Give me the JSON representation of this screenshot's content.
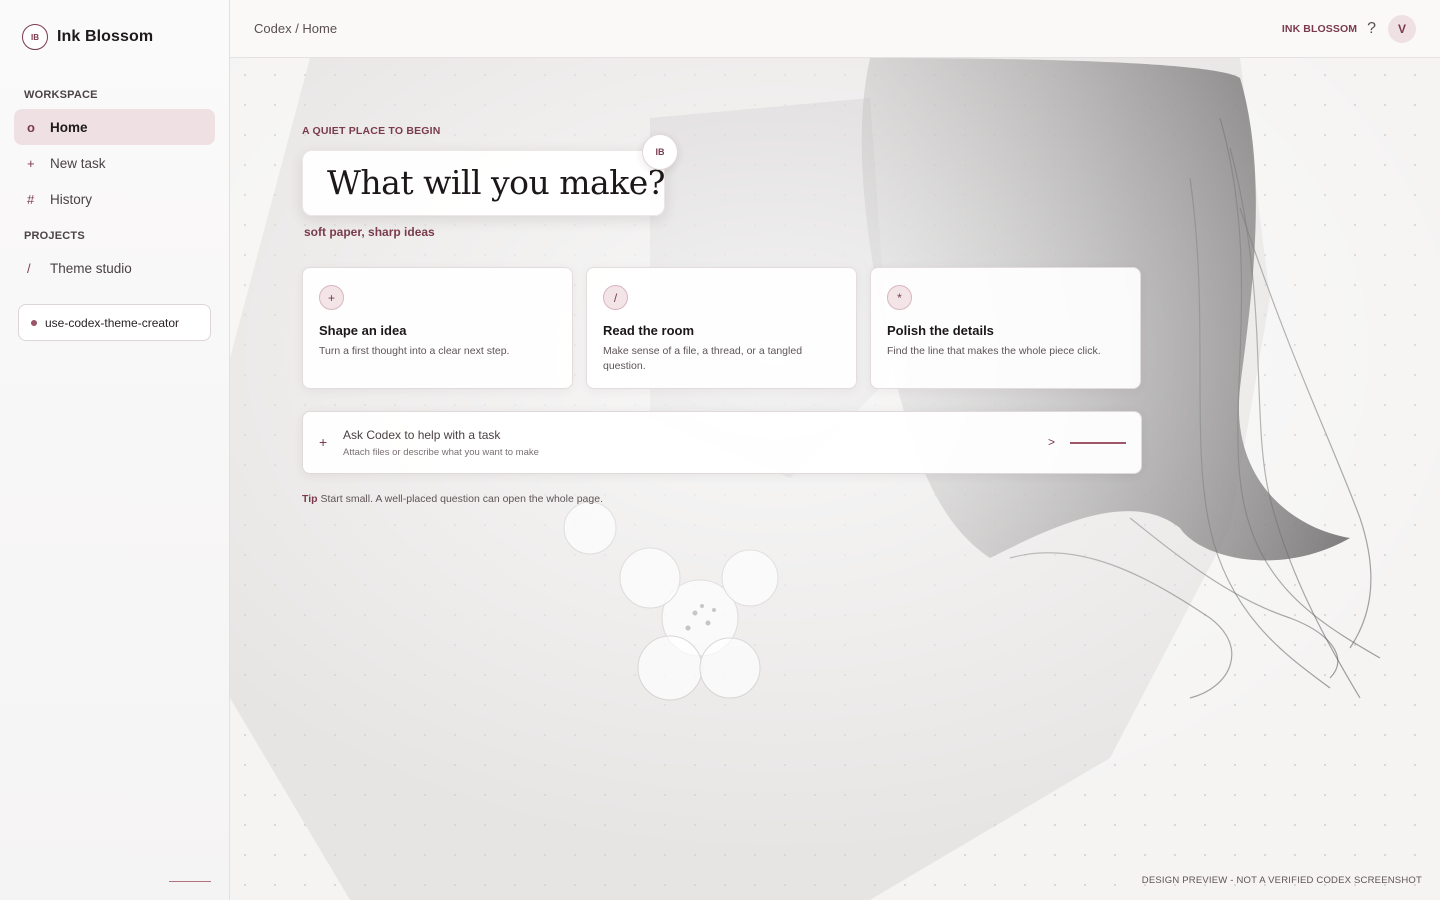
{
  "brand": {
    "mark": "IB",
    "name": "Ink Blossom"
  },
  "sidebar": {
    "workspace_label": "WORKSPACE",
    "workspace_items": [
      {
        "glyph": "o",
        "label": "Home",
        "active": true
      },
      {
        "glyph": "+",
        "label": "New task",
        "active": false
      },
      {
        "glyph": "#",
        "label": "History",
        "active": false
      }
    ],
    "projects_label": "PROJECTS",
    "project_items": [
      {
        "glyph": "/",
        "label": "Theme studio"
      }
    ],
    "repo_chip": "use-codex-theme-creator"
  },
  "header": {
    "breadcrumb": "Codex / Home",
    "workspace_name": "INK BLOSSOM",
    "help_glyph": "?",
    "avatar_initial": "V"
  },
  "hero": {
    "eyebrow": "A QUIET PLACE TO BEGIN",
    "title": "What will you make?",
    "badge": "IB",
    "tagline": "soft paper, sharp ideas"
  },
  "cards": [
    {
      "icon": "+",
      "title": "Shape an idea",
      "desc": "Turn a first thought into a clear next step."
    },
    {
      "icon": "/",
      "title": "Read the room",
      "desc": "Make sense of a file, a thread, or a tangled question."
    },
    {
      "icon": "*",
      "title": "Polish the details",
      "desc": "Find the line that makes the whole piece click."
    }
  ],
  "composer": {
    "attach_glyph": "+",
    "prompt": "Ask Codex to help with a task",
    "subtext": "Attach files or describe what you want to make",
    "send_glyph": ">"
  },
  "tip": {
    "label": "Tip",
    "text": "Start small. A well-placed question can open the whole page."
  },
  "footer_note": "DESIGN PREVIEW - NOT A VERIFIED CODEX SCREENSHOT",
  "colors": {
    "accent": "#7a3b4c",
    "active_bg": "#efe0e3",
    "paper": "#f5f4f3"
  }
}
